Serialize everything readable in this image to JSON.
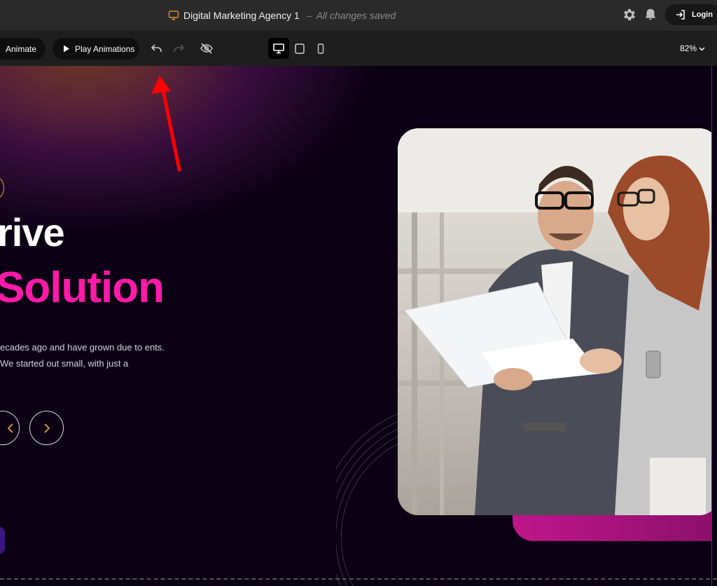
{
  "header": {
    "doc_title": "Digital Marketing Agency 1",
    "separator": "–",
    "save_status": "All changes saved",
    "login_label": "Login",
    "icons": [
      "monitor-icon",
      "gear-icon",
      "bell-icon",
      "login-icon"
    ]
  },
  "toolbar": {
    "animate_label": "Animate",
    "play_label": "Play Animations",
    "zoom": "82%",
    "active_device": "desktop",
    "icons": [
      "play-icon",
      "undo-icon",
      "redo-icon",
      "hide-icon",
      "desktop-icon",
      "tablet-icon",
      "mobile-icon",
      "chevron-down-icon"
    ]
  },
  "hero": {
    "heading_line1": "rive",
    "heading_line2": "Solution",
    "paragraph": "ecades ago and have grown due to ents. We started out small, with just a",
    "accent_color": "#ff1aa8",
    "background_color": "#0b0014"
  },
  "colors": {
    "topbar": "#2a2a2a",
    "toolbar": "#1e1e1e",
    "pink_bar": "#c0168a",
    "arrow": "#ff0000"
  }
}
